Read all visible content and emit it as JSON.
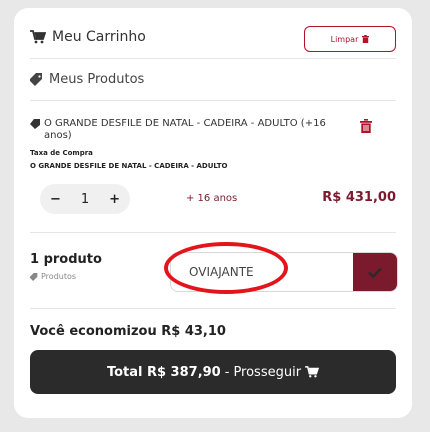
{
  "header": {
    "title": "Meu Carrinho",
    "clear_label": "Limpar"
  },
  "products_section": {
    "title": "Meus Produtos"
  },
  "item": {
    "name": "O GRANDE DESFILE DE NATAL - CADEIRA - ADULTO (+16 anos)",
    "tax_label": "Taxa de Compra",
    "tax_description": "O GRANDE DESFILE DE NATAL - CADEIRA - ADULTO",
    "quantity": "1",
    "minus": "−",
    "plus": "+",
    "age": "+ 16 anos",
    "price": "R$ 431,00"
  },
  "summary": {
    "count": "1 produto",
    "sub": "Produtos"
  },
  "coupon": {
    "value": "OVIAJANTE"
  },
  "savings": "Você economizou R$ 43,10",
  "checkout": {
    "total": "Total R$ 387,90",
    "separator": "-",
    "action": "Prosseguir"
  },
  "colors": {
    "accent": "#7a1a2c",
    "highlight": "#e3141a",
    "dark_button": "#2b2b2b"
  }
}
